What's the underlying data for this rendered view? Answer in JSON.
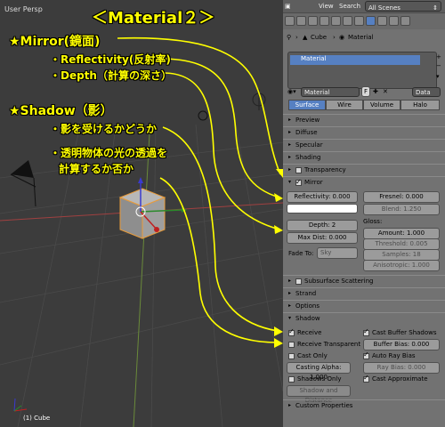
{
  "viewport": {
    "label": "User Persp",
    "object_label": "(1) Cube"
  },
  "annotations": {
    "title": "＜Material２＞",
    "mirror": "★Mirror(鏡面)",
    "reflectivity": "・Reflectivity(反射率)",
    "depth": "・Depth（計算の深さ）",
    "shadow": "★Shadow（影）",
    "receive": "・影を受けるかどうか",
    "transparent_line1": "・透明物体の光の透過を",
    "transparent_line2": "計算するか否か",
    "color": "#ffff00"
  },
  "header": {
    "view": "View",
    "search": "Search",
    "scenes": "All Scenes"
  },
  "breadcrumb": {
    "cube": "Cube",
    "material": "Material"
  },
  "slots": {
    "item": "Material"
  },
  "material_row": {
    "name": "Material",
    "f": "F",
    "data": "Data"
  },
  "tabs": [
    "Surface",
    "Wire",
    "Volume",
    "Halo"
  ],
  "sections": {
    "preview": "Preview",
    "diffuse": "Diffuse",
    "specular": "Specular",
    "shading": "Shading",
    "transparency": "Transparency",
    "mirror": "Mirror",
    "subsurface": "Subsurface Scattering",
    "strand": "Strand",
    "options": "Options",
    "shadow": "Shadow",
    "custom": "Custom Properties"
  },
  "mirror": {
    "reflectivity": "Reflectivity: 0.000",
    "fresnel": "Fresnel: 0.000",
    "blend": "Blend: 1.250",
    "depth": "Depth: 2",
    "max_dist": "Max Dist: 0.000",
    "fade_to": "Fade To:",
    "sky": "Sky",
    "gloss": "Gloss:",
    "amount": "Amount: 1.000",
    "threshold": "Threshold: 0.005",
    "samples": "Samples: 18",
    "anisotropic": "Anisotropic: 1.000",
    "swatch_color": "#ffffff"
  },
  "shadow": {
    "receive": "Receive",
    "receive_transparent": "Receive Transparent",
    "cast_only": "Cast Only",
    "casting_alpha": "Casting Alpha: 1.000",
    "shadows_only": "Shadows Only",
    "shadow_distance": "Shadow and Distance",
    "cast_buffer": "Cast Buffer Shadows",
    "buffer_bias": "Buffer Bias: 0.000",
    "auto_ray_bias": "Auto Ray Bias",
    "ray_bias": "Ray Bias: 0.000",
    "cast_approx": "Cast Approximate"
  }
}
